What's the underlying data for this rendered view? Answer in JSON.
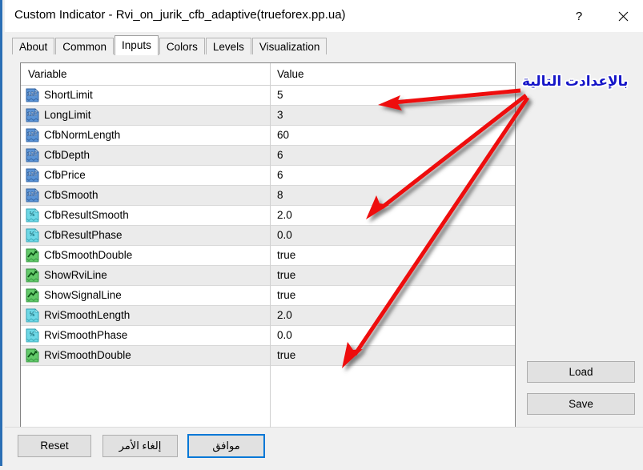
{
  "window": {
    "title": "Custom Indicator - Rvi_on_jurik_cfb_adaptive(trueforex.pp.ua)",
    "help_label": "?",
    "close_label": "×"
  },
  "tabs": [
    {
      "label": "About",
      "active": false
    },
    {
      "label": "Common",
      "active": false
    },
    {
      "label": "Inputs",
      "active": true
    },
    {
      "label": "Colors",
      "active": false
    },
    {
      "label": "Levels",
      "active": false
    },
    {
      "label": "Visualization",
      "active": false
    }
  ],
  "table": {
    "headers": [
      "Variable",
      "Value"
    ],
    "rows": [
      {
        "icon": "integer-variable-icon",
        "name": "ShortLimit",
        "value": "5"
      },
      {
        "icon": "integer-variable-icon",
        "name": "LongLimit",
        "value": "3"
      },
      {
        "icon": "integer-variable-icon",
        "name": "CfbNormLength",
        "value": "60"
      },
      {
        "icon": "integer-variable-icon",
        "name": "CfbDepth",
        "value": "6"
      },
      {
        "icon": "integer-variable-icon",
        "name": "CfbPrice",
        "value": "6"
      },
      {
        "icon": "integer-variable-icon",
        "name": "CfbSmooth",
        "value": "8"
      },
      {
        "icon": "float-variable-icon",
        "name": "CfbResultSmooth",
        "value": "2.0"
      },
      {
        "icon": "float-variable-icon",
        "name": "CfbResultPhase",
        "value": "0.0"
      },
      {
        "icon": "boolean-variable-icon",
        "name": "CfbSmoothDouble",
        "value": "true"
      },
      {
        "icon": "boolean-variable-icon",
        "name": "ShowRviLine",
        "value": "true"
      },
      {
        "icon": "boolean-variable-icon",
        "name": "ShowSignalLine",
        "value": "true"
      },
      {
        "icon": "float-variable-icon",
        "name": "RviSmoothLength",
        "value": "2.0"
      },
      {
        "icon": "float-variable-icon",
        "name": "RviSmoothPhase",
        "value": "0.0"
      },
      {
        "icon": "boolean-variable-icon",
        "name": "RviSmoothDouble",
        "value": "true"
      }
    ]
  },
  "side_buttons": {
    "load_label": "Load",
    "save_label": "Save"
  },
  "footer_buttons": {
    "reset_label": "Reset",
    "cancel_label": "إلغاء الأمر",
    "ok_label": "موافق"
  },
  "annotation": {
    "text": "بالإعدادت التالية",
    "text_color": "#1616c8",
    "arrow_color": "#ee1111",
    "arrow_count": 3
  },
  "colors": {
    "accent": "#0078d7",
    "window_bg": "#f0f0f0",
    "row_alt": "#ebebeb",
    "integer_icon": "#4a86c8",
    "float_icon": "#35c4d4",
    "boolean_icon": "#3cba54"
  }
}
